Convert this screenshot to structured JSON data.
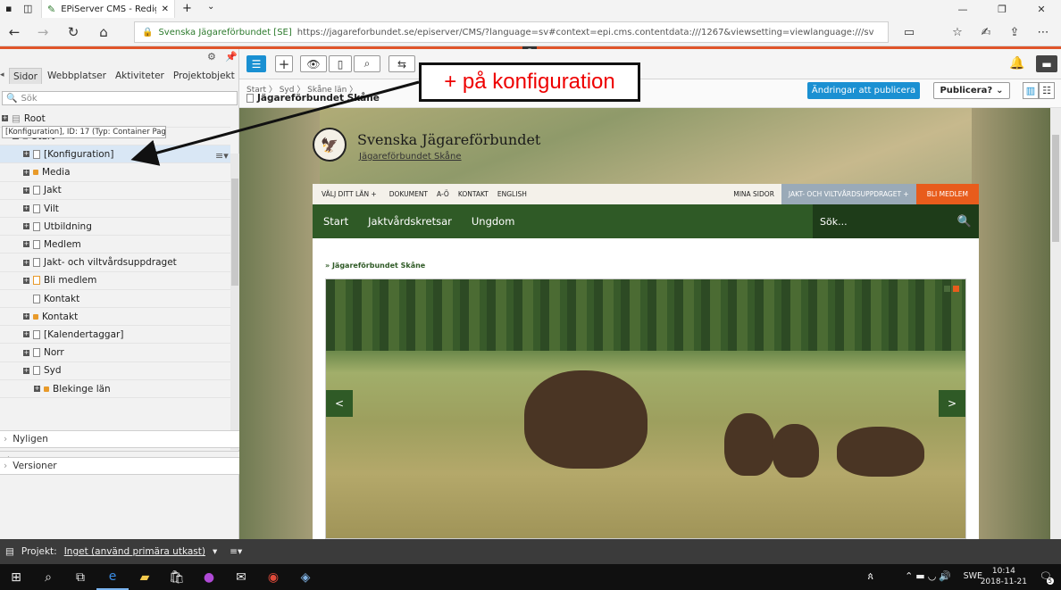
{
  "browser": {
    "tab_title": "EPiServer CMS - Redige",
    "site_label": "Svenska Jägareförbundet [SE]",
    "url": "https://jagareforbundet.se/episerver/CMS/?language=sv#context=epi.cms.contentdata:///1267&viewsetting=viewlanguage:///sv"
  },
  "left": {
    "tabs": [
      "Sidor",
      "Webbplatser",
      "Aktiviteter",
      "Projektobjekt"
    ],
    "search_placeholder": "Sök",
    "tooltip": "[Konfiguration], ID: 17 (Typ: Container Page)",
    "tree": [
      {
        "label": "Root",
        "level": 0,
        "exp": true,
        "type": "root"
      },
      {
        "label": "Start",
        "level": 1,
        "exp": true,
        "type": "home"
      },
      {
        "label": "[Konfiguration]",
        "level": 2,
        "exp": true,
        "type": "page",
        "hl": true
      },
      {
        "label": "Media",
        "level": 2,
        "exp": true,
        "type": "folder"
      },
      {
        "label": "Jakt",
        "level": 2,
        "exp": true,
        "type": "page"
      },
      {
        "label": "Vilt",
        "level": 2,
        "exp": true,
        "type": "page"
      },
      {
        "label": "Utbildning",
        "level": 2,
        "exp": true,
        "type": "page"
      },
      {
        "label": "Medlem",
        "level": 2,
        "exp": true,
        "type": "page"
      },
      {
        "label": "Jakt- och viltvårdsuppdraget",
        "level": 2,
        "exp": true,
        "type": "page"
      },
      {
        "label": "Bli medlem",
        "level": 2,
        "exp": true,
        "type": "pagefolder"
      },
      {
        "label": "Kontakt",
        "level": 2,
        "exp": false,
        "type": "page"
      },
      {
        "label": "Kontakt",
        "level": 2,
        "exp": true,
        "type": "folder"
      },
      {
        "label": "[Kalendertaggar]",
        "level": 2,
        "exp": true,
        "type": "page"
      },
      {
        "label": "Norr",
        "level": 2,
        "exp": true,
        "type": "page"
      },
      {
        "label": "Syd",
        "level": 2,
        "exp": true,
        "type": "page"
      },
      {
        "label": "Blekinge län",
        "level": 3,
        "exp": true,
        "type": "folder"
      }
    ],
    "recent": "Nyligen",
    "versions": "Versioner"
  },
  "editor": {
    "breadcrumb": "Start 〉 Syd 〉 Skåne län 〉",
    "page_title": "Jägareförbundet Skåne",
    "changes_label": "Ändringar att publicera",
    "publish_label": "Publicera?"
  },
  "site": {
    "org_name": "Svenska Jägareförbundet",
    "sub_org": "Jägareförbundet Skåne",
    "top_nav": [
      "VÄLJ DITT LÄN +",
      "DOKUMENT",
      "A-Ö",
      "KONTAKT",
      "ENGLISH"
    ],
    "mina": "MINA SIDOR",
    "jakt": "JAKT- OCH VILTVÅRDSUPPDRAGET +",
    "bli": "BLI MEDLEM",
    "main_nav": [
      "Start",
      "Jaktvårdskretsar",
      "Ungdom"
    ],
    "search_placeholder": "Sök...",
    "breadcrumb": "» Jägareförbundet Skåne",
    "prev": "<",
    "next": ">"
  },
  "annotation": "+ på konfiguration",
  "project": {
    "label": "Projekt:",
    "value": "Inget (använd primära utkast)"
  },
  "taskbar": {
    "lang": "SWE",
    "time": "10:14",
    "date": "2018-11-21",
    "badge": "5"
  },
  "colors": {
    "accent": "#1a90d2",
    "forest": "#2f5a26",
    "orange": "#e85c1c",
    "annotation": "#e00000"
  }
}
